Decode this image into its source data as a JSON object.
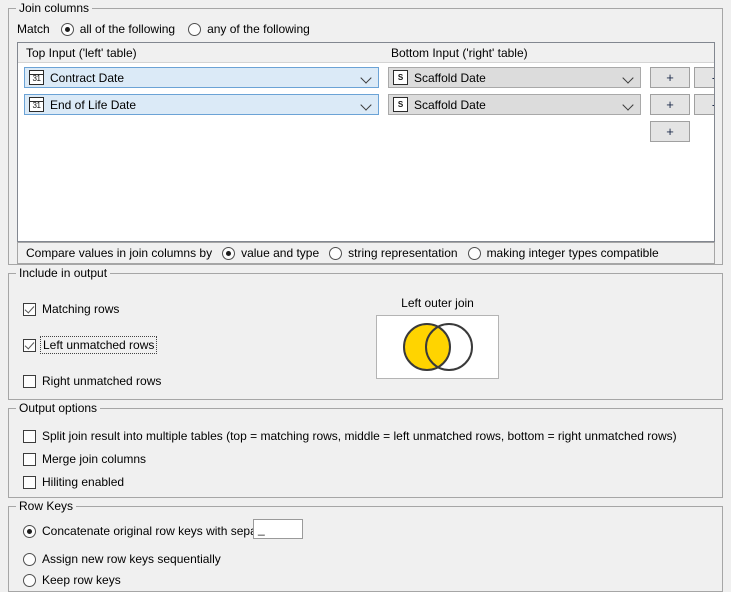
{
  "join_columns": {
    "legend": "Join columns",
    "match_label": "Match",
    "match_options": [
      {
        "label": "all of the following",
        "selected": true
      },
      {
        "label": "any of the following",
        "selected": false
      }
    ],
    "headers": {
      "left": "Top Input ('left' table)",
      "right": "Bottom Input ('right' table)"
    },
    "rows": [
      {
        "left": {
          "value": "Contract Date",
          "icon": "date-icon",
          "icon_text": "31"
        },
        "right": {
          "value": "Scaffold Date",
          "icon": "string-icon",
          "icon_text": "S"
        },
        "add_label": "+",
        "remove_label": "-"
      },
      {
        "left": {
          "value": "End of Life Date",
          "icon": "date-icon",
          "icon_text": "31"
        },
        "right": {
          "value": "Scaffold Date",
          "icon": "string-icon",
          "icon_text": "S"
        },
        "add_label": "+",
        "remove_label": "-"
      }
    ],
    "add_row_label": "+",
    "compare": {
      "label": "Compare values in join columns by",
      "options": [
        {
          "label": "value and type",
          "selected": true
        },
        {
          "label": "string representation",
          "selected": false
        },
        {
          "label": "making integer types compatible",
          "selected": false
        }
      ]
    }
  },
  "include_in_output": {
    "legend": "Include in output",
    "checkboxes": [
      {
        "label": "Matching rows",
        "checked": true,
        "focused": false
      },
      {
        "label": "Left unmatched rows",
        "checked": true,
        "focused": true
      },
      {
        "label": "Right unmatched rows",
        "checked": false,
        "focused": false
      }
    ],
    "diagram": {
      "title": "Left outer join",
      "left_circle_fill": "#FFD400",
      "right_circle_fill": "#FFFFFF",
      "stroke": "#3a3a3a"
    }
  },
  "output_options": {
    "legend": "Output options",
    "checkboxes": [
      {
        "label": "Split join result into multiple tables (top = matching rows, middle = left unmatched rows, bottom = right unmatched rows)",
        "checked": false
      },
      {
        "label": "Merge join columns",
        "checked": false
      },
      {
        "label": "Hiliting enabled",
        "checked": false
      }
    ]
  },
  "row_keys": {
    "legend": "Row Keys",
    "options": [
      {
        "label": "Concatenate original row keys with separator",
        "selected": true
      },
      {
        "label": "Assign new row keys sequentially",
        "selected": false
      },
      {
        "label": "Keep row keys",
        "selected": false
      }
    ],
    "separator_value": "_"
  }
}
